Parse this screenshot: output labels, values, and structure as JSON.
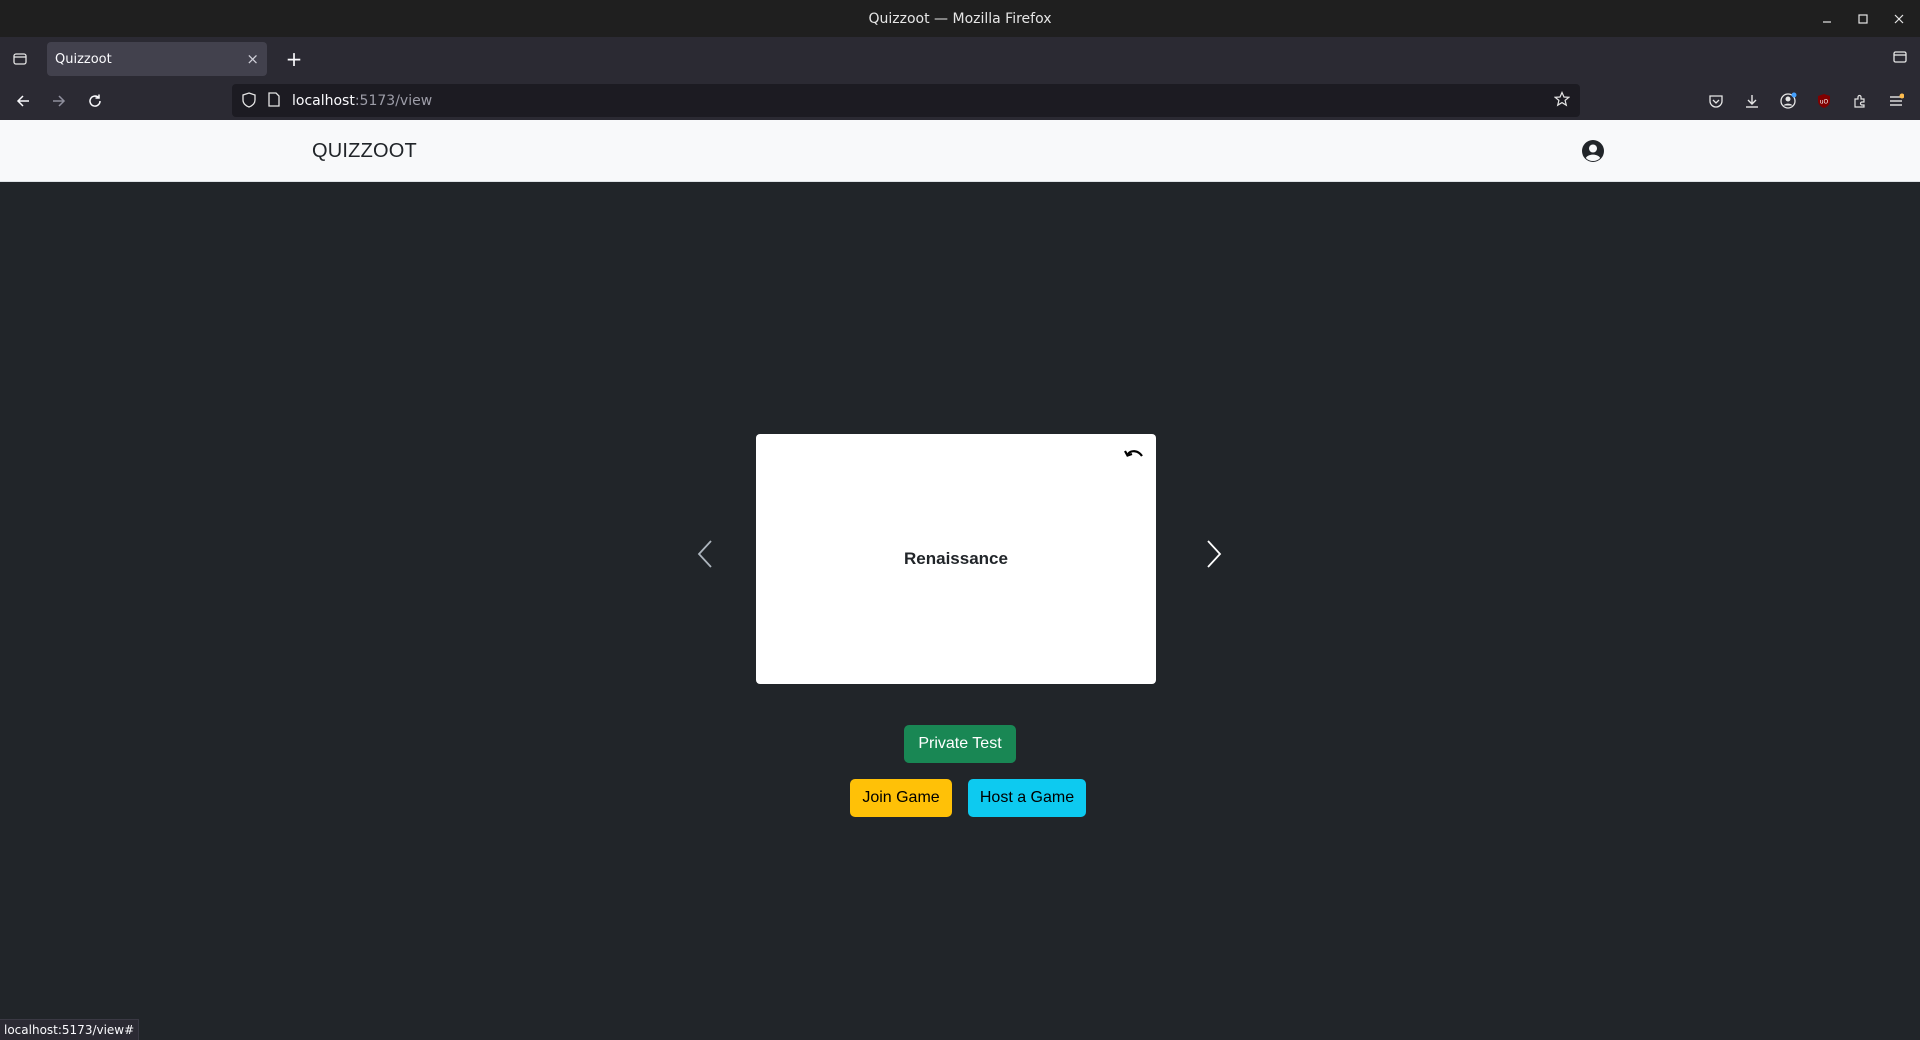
{
  "window": {
    "title": "Quizzoot — Mozilla Firefox",
    "controls": [
      "minimize-icon",
      "maximize-icon",
      "close-icon"
    ]
  },
  "browser": {
    "tab_title": "Quizzoot",
    "url_host": "localhost",
    "url_path": ":5173/view",
    "status_url": "localhost:5173/view#"
  },
  "app": {
    "brand": "QUIZZOOT",
    "card": {
      "term": "Renaissance"
    },
    "buttons": {
      "private_test": "Private Test",
      "join_game": "Join Game",
      "host_game": "Host a Game"
    }
  },
  "colors": {
    "page_bg": "#212529",
    "navbar_bg": "#f8f9fa",
    "private_test": "#198754",
    "join_game": "#ffc107",
    "host_game": "#0dcaf0"
  }
}
